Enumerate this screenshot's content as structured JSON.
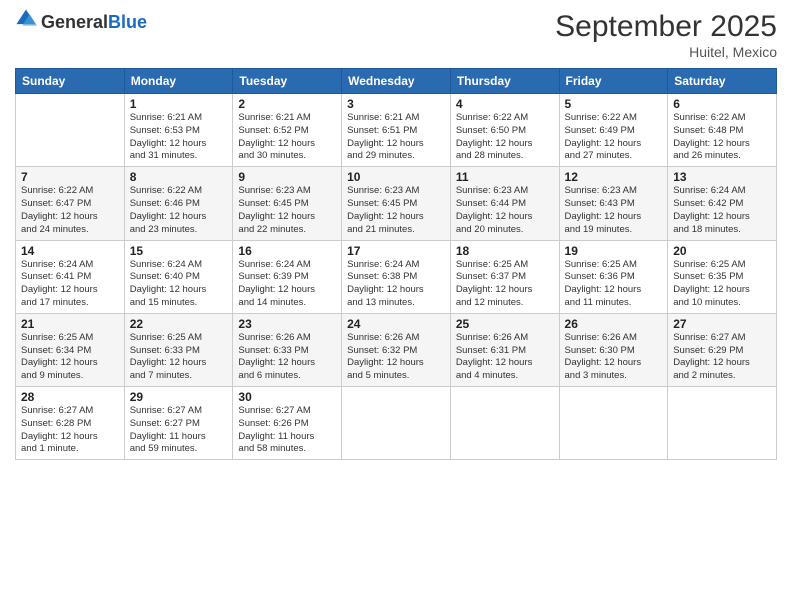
{
  "header": {
    "logo": {
      "general": "General",
      "blue": "Blue"
    },
    "title": "September 2025",
    "location": "Huitel, Mexico"
  },
  "weekdays": [
    "Sunday",
    "Monday",
    "Tuesday",
    "Wednesday",
    "Thursday",
    "Friday",
    "Saturday"
  ],
  "weeks": [
    [
      {
        "day": "",
        "info": ""
      },
      {
        "day": "1",
        "info": "Sunrise: 6:21 AM\nSunset: 6:53 PM\nDaylight: 12 hours\nand 31 minutes."
      },
      {
        "day": "2",
        "info": "Sunrise: 6:21 AM\nSunset: 6:52 PM\nDaylight: 12 hours\nand 30 minutes."
      },
      {
        "day": "3",
        "info": "Sunrise: 6:21 AM\nSunset: 6:51 PM\nDaylight: 12 hours\nand 29 minutes."
      },
      {
        "day": "4",
        "info": "Sunrise: 6:22 AM\nSunset: 6:50 PM\nDaylight: 12 hours\nand 28 minutes."
      },
      {
        "day": "5",
        "info": "Sunrise: 6:22 AM\nSunset: 6:49 PM\nDaylight: 12 hours\nand 27 minutes."
      },
      {
        "day": "6",
        "info": "Sunrise: 6:22 AM\nSunset: 6:48 PM\nDaylight: 12 hours\nand 26 minutes."
      }
    ],
    [
      {
        "day": "7",
        "info": "Sunrise: 6:22 AM\nSunset: 6:47 PM\nDaylight: 12 hours\nand 24 minutes."
      },
      {
        "day": "8",
        "info": "Sunrise: 6:22 AM\nSunset: 6:46 PM\nDaylight: 12 hours\nand 23 minutes."
      },
      {
        "day": "9",
        "info": "Sunrise: 6:23 AM\nSunset: 6:45 PM\nDaylight: 12 hours\nand 22 minutes."
      },
      {
        "day": "10",
        "info": "Sunrise: 6:23 AM\nSunset: 6:45 PM\nDaylight: 12 hours\nand 21 minutes."
      },
      {
        "day": "11",
        "info": "Sunrise: 6:23 AM\nSunset: 6:44 PM\nDaylight: 12 hours\nand 20 minutes."
      },
      {
        "day": "12",
        "info": "Sunrise: 6:23 AM\nSunset: 6:43 PM\nDaylight: 12 hours\nand 19 minutes."
      },
      {
        "day": "13",
        "info": "Sunrise: 6:24 AM\nSunset: 6:42 PM\nDaylight: 12 hours\nand 18 minutes."
      }
    ],
    [
      {
        "day": "14",
        "info": "Sunrise: 6:24 AM\nSunset: 6:41 PM\nDaylight: 12 hours\nand 17 minutes."
      },
      {
        "day": "15",
        "info": "Sunrise: 6:24 AM\nSunset: 6:40 PM\nDaylight: 12 hours\nand 15 minutes."
      },
      {
        "day": "16",
        "info": "Sunrise: 6:24 AM\nSunset: 6:39 PM\nDaylight: 12 hours\nand 14 minutes."
      },
      {
        "day": "17",
        "info": "Sunrise: 6:24 AM\nSunset: 6:38 PM\nDaylight: 12 hours\nand 13 minutes."
      },
      {
        "day": "18",
        "info": "Sunrise: 6:25 AM\nSunset: 6:37 PM\nDaylight: 12 hours\nand 12 minutes."
      },
      {
        "day": "19",
        "info": "Sunrise: 6:25 AM\nSunset: 6:36 PM\nDaylight: 12 hours\nand 11 minutes."
      },
      {
        "day": "20",
        "info": "Sunrise: 6:25 AM\nSunset: 6:35 PM\nDaylight: 12 hours\nand 10 minutes."
      }
    ],
    [
      {
        "day": "21",
        "info": "Sunrise: 6:25 AM\nSunset: 6:34 PM\nDaylight: 12 hours\nand 9 minutes."
      },
      {
        "day": "22",
        "info": "Sunrise: 6:25 AM\nSunset: 6:33 PM\nDaylight: 12 hours\nand 7 minutes."
      },
      {
        "day": "23",
        "info": "Sunrise: 6:26 AM\nSunset: 6:33 PM\nDaylight: 12 hours\nand 6 minutes."
      },
      {
        "day": "24",
        "info": "Sunrise: 6:26 AM\nSunset: 6:32 PM\nDaylight: 12 hours\nand 5 minutes."
      },
      {
        "day": "25",
        "info": "Sunrise: 6:26 AM\nSunset: 6:31 PM\nDaylight: 12 hours\nand 4 minutes."
      },
      {
        "day": "26",
        "info": "Sunrise: 6:26 AM\nSunset: 6:30 PM\nDaylight: 12 hours\nand 3 minutes."
      },
      {
        "day": "27",
        "info": "Sunrise: 6:27 AM\nSunset: 6:29 PM\nDaylight: 12 hours\nand 2 minutes."
      }
    ],
    [
      {
        "day": "28",
        "info": "Sunrise: 6:27 AM\nSunset: 6:28 PM\nDaylight: 12 hours\nand 1 minute."
      },
      {
        "day": "29",
        "info": "Sunrise: 6:27 AM\nSunset: 6:27 PM\nDaylight: 11 hours\nand 59 minutes."
      },
      {
        "day": "30",
        "info": "Sunrise: 6:27 AM\nSunset: 6:26 PM\nDaylight: 11 hours\nand 58 minutes."
      },
      {
        "day": "",
        "info": ""
      },
      {
        "day": "",
        "info": ""
      },
      {
        "day": "",
        "info": ""
      },
      {
        "day": "",
        "info": ""
      }
    ]
  ]
}
